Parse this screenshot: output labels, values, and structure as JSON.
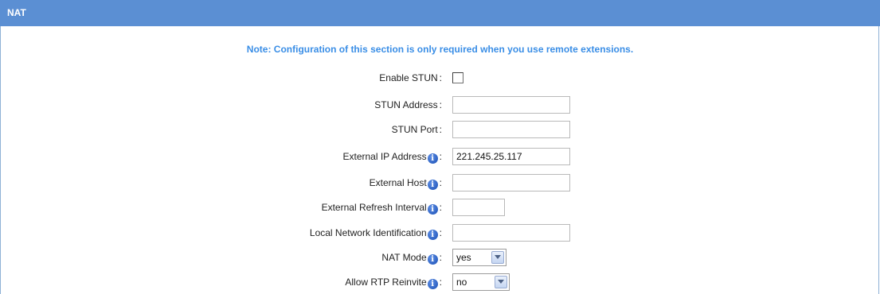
{
  "section": {
    "title": "NAT"
  },
  "note": "Note: Configuration of this section is only required when you use remote extensions.",
  "fields": {
    "enable_stun": {
      "label": "Enable STUN",
      "checked": false
    },
    "stun_address": {
      "label": "STUN Address",
      "value": ""
    },
    "stun_port": {
      "label": "STUN Port",
      "value": ""
    },
    "external_ip": {
      "label": "External IP Address",
      "value": "221.245.25.117"
    },
    "external_host": {
      "label": "External Host",
      "value": ""
    },
    "external_refresh": {
      "label": "External Refresh Interval",
      "value": ""
    },
    "local_network": {
      "label": "Local Network Identification",
      "value": ""
    },
    "nat_mode": {
      "label": "NAT Mode",
      "value": "yes"
    },
    "allow_rtp_reinvite": {
      "label": "Allow RTP Reinvite",
      "value": "no"
    }
  },
  "colon": ":",
  "info_glyph": "i",
  "colors": {
    "header_bg": "#5b8fd3",
    "note_text": "#3a8ee6",
    "info_icon": "#1a4fb3"
  }
}
